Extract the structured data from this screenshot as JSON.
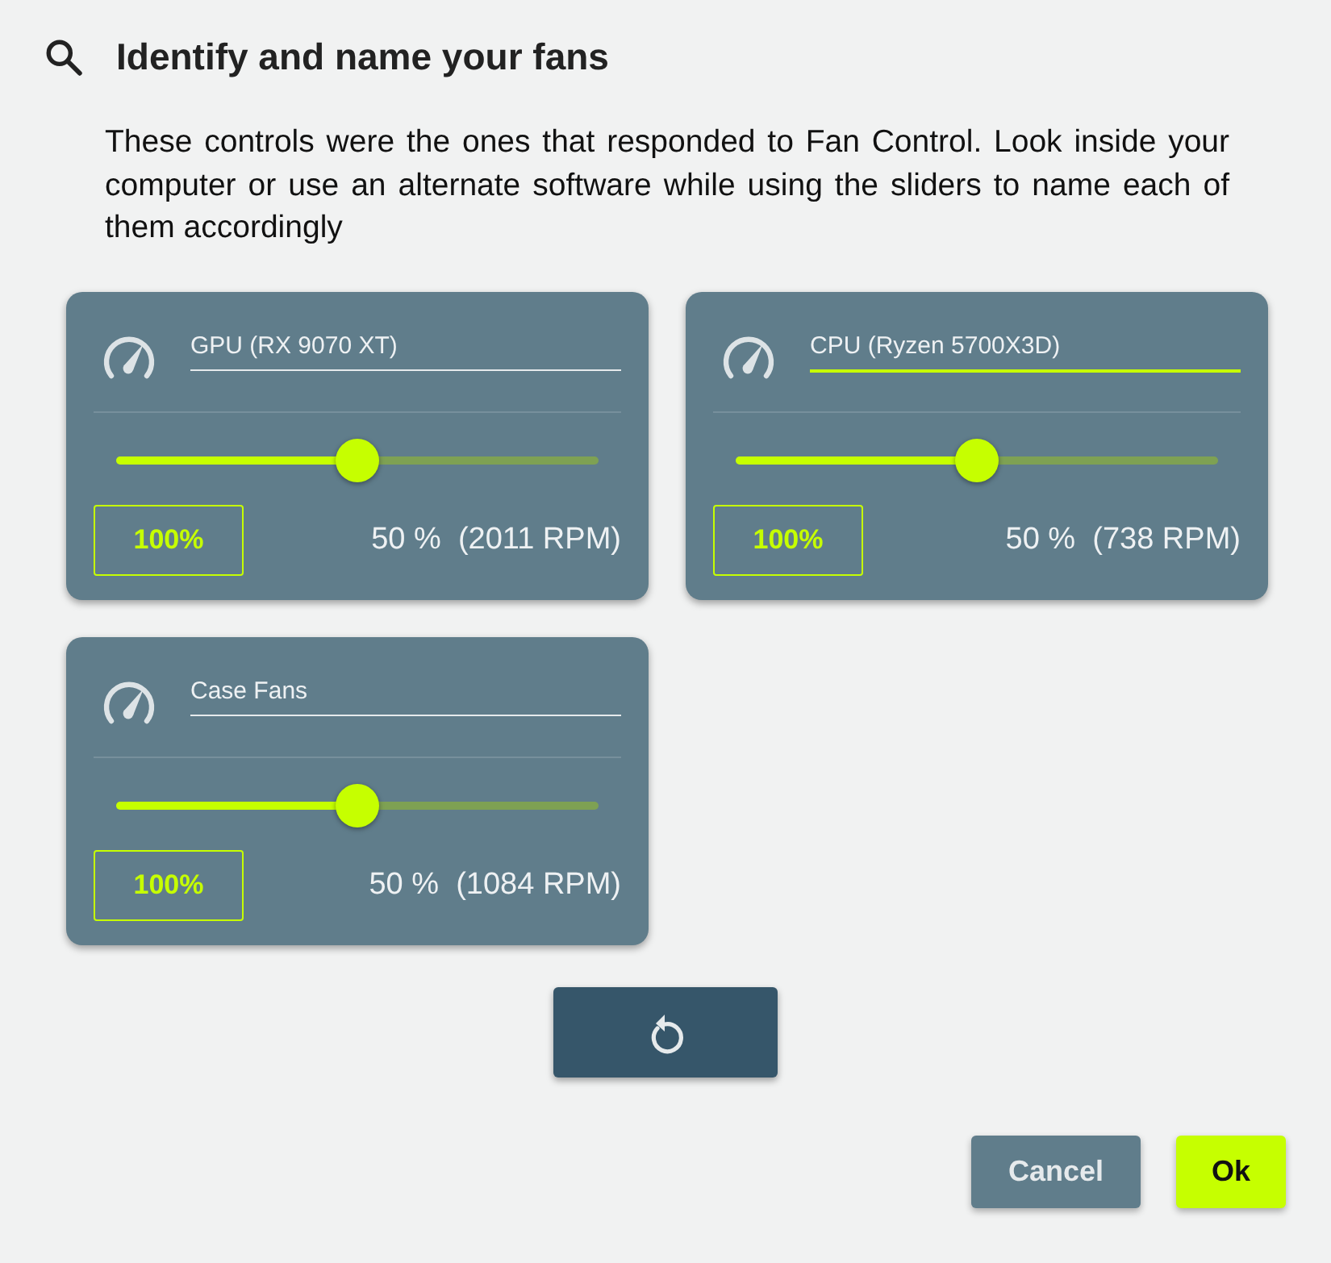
{
  "dialog": {
    "title": "Identify and name your fans",
    "description": "These controls were the ones that responded to Fan Control. Look inside your computer or use an alternate software while using the sliders to name each of them accordingly",
    "fans": [
      {
        "name": "GPU (RX 9070 XT)",
        "focused": false,
        "level": 0.5,
        "max_button": "100%",
        "reading": "50 %  (2011 RPM)"
      },
      {
        "name": "CPU (Ryzen 5700X3D)",
        "focused": true,
        "level": 0.5,
        "max_button": "100%",
        "reading": "50 %  (738 RPM)"
      },
      {
        "name": "Case Fans",
        "focused": false,
        "level": 0.5,
        "max_button": "100%",
        "reading": "50 %  (1084 RPM)"
      }
    ],
    "buttons": [
      {
        "label": "Cancel",
        "kind": "secondary"
      },
      {
        "label": "Ok",
        "kind": "primary"
      }
    ]
  }
}
